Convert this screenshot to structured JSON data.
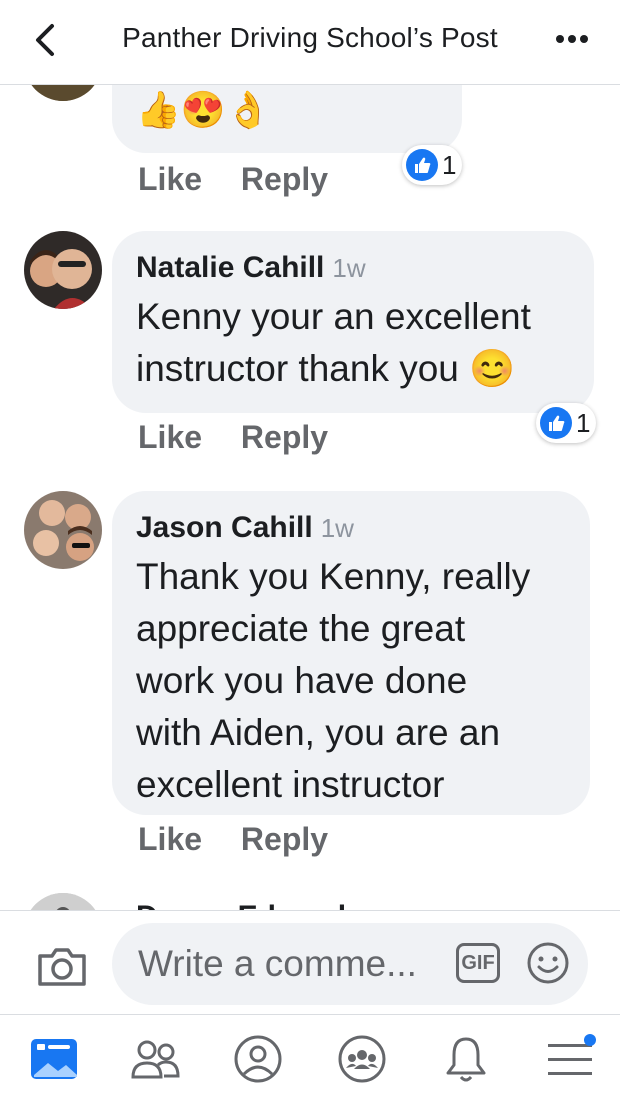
{
  "header": {
    "title": "Panther Driving School’s Post"
  },
  "comments": [
    {
      "name": "",
      "time": "",
      "text": "👍😍👌",
      "actions": {
        "like": "Like",
        "reply": "Reply"
      },
      "reaction_count": "1"
    },
    {
      "name": "Natalie Cahill",
      "time": "1w",
      "text_lines": [
        "Kenny your an excellent",
        "instructor thank you 😊"
      ],
      "actions": {
        "like": "Like",
        "reply": "Reply"
      },
      "reaction_count": "1"
    },
    {
      "name": "Jason Cahill",
      "time": "1w",
      "text_lines": [
        "Thank you Kenny, really",
        "appreciate the great",
        "work you have done",
        "with Aiden, you are an",
        "excellent instructor"
      ],
      "actions": {
        "like": "Like",
        "reply": "Reply"
      }
    }
  ],
  "partial_next_comment": {
    "name": "Donna Edwards"
  },
  "composer": {
    "placeholder": "Write a comme...",
    "gif_label": "GIF"
  },
  "tabs": [
    "news-feed",
    "friends",
    "profile",
    "groups",
    "notifications",
    "menu"
  ],
  "colors": {
    "accent": "#1877f2",
    "bubble": "#f0f2f5",
    "secondary_text": "#65676b"
  }
}
